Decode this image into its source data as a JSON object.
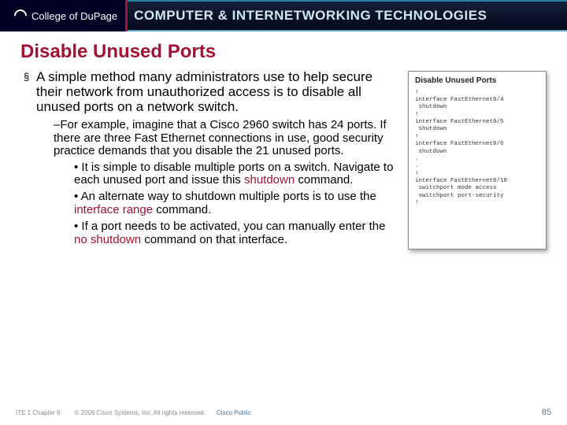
{
  "header": {
    "org": "College of DuPage",
    "banner": "COMPUTER & INTERNETWORKING TECHNOLOGIES"
  },
  "slide": {
    "title": "Disable Unused Ports",
    "main": "A simple method many administrators use to help secure their network from unauthorized access is to disable all unused ports on a network switch.",
    "sub": "–For example, imagine that a Cisco 2960 switch has 24 ports. If there are three Fast Ethernet connections in use, good security practice demands that you disable the 21 unused ports.",
    "b1_pre": "• It is simple to disable multiple ports on a switch. Navigate to each unused port and issue this ",
    "b1_cmd": "shutdown",
    "b1_post": " command.",
    "b2_pre": "• An alternate way to shutdown multiple ports is to use the ",
    "b2_cmd": "interface range",
    "b2_post": " command.",
    "b3_pre": "• If a port needs to be activated, you can manually enter the ",
    "b3_cmd": "no shutdown",
    "b3_post": " command on that interface."
  },
  "codebox": {
    "title": "Disable Unused Ports",
    "text": "!\ninterface FastEthernet0/4\n shutdown\n!\ninterface FastEthernet0/5\n shutdown\n!\ninterface FastEthernet0/6\n shutdown\n.\n.\n!\ninterface FastEthernet0/18\n switchport mode access\n switchport port-security\n!"
  },
  "footer": {
    "left": "ITE 1 Chapter 6",
    "copyright": "© 2006 Cisco Systems, Inc. All rights reserved.",
    "cisco": "Cisco Public",
    "page": "85"
  }
}
